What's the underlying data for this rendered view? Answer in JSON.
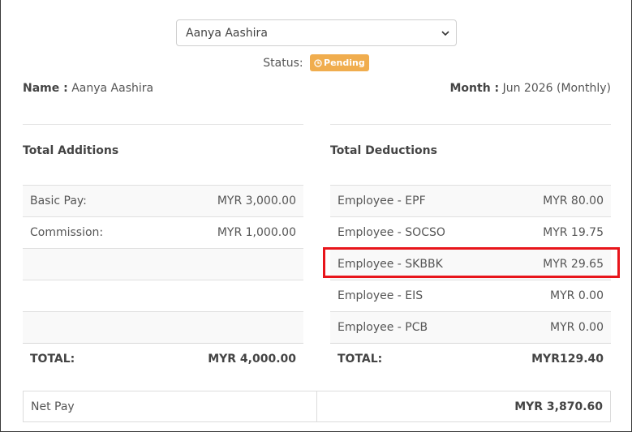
{
  "employee_select": {
    "value": "Aanya Aashira"
  },
  "status": {
    "label": "Status:",
    "badge": "Pending",
    "badge_color": "#f0ad4e"
  },
  "info": {
    "name_label": "Name :",
    "name_value": "Aanya Aashira",
    "month_label": "Month :",
    "month_value": "Jun 2026 (Monthly)"
  },
  "additions": {
    "title": "Total Additions",
    "rows": [
      {
        "label": "Basic Pay:",
        "amount": "MYR 3,000.00"
      },
      {
        "label": "Commission:",
        "amount": "MYR 1,000.00"
      },
      {
        "label": "",
        "amount": ""
      },
      {
        "label": "",
        "amount": ""
      },
      {
        "label": "",
        "amount": ""
      }
    ],
    "total_label": "TOTAL:",
    "total_amount": "MYR 4,000.00"
  },
  "deductions": {
    "title": "Total Deductions",
    "rows": [
      {
        "label": "Employee - EPF",
        "amount": "MYR 80.00"
      },
      {
        "label": "Employee - SOCSO",
        "amount": "MYR 19.75"
      },
      {
        "label": "Employee - SKBBK",
        "amount": "MYR 29.65"
      },
      {
        "label": "Employee - EIS",
        "amount": "MYR 0.00"
      },
      {
        "label": "Employee - PCB",
        "amount": "MYR 0.00"
      }
    ],
    "total_label": "TOTAL:",
    "total_amount": "MYR129.40"
  },
  "net_pay": {
    "label": "Net Pay",
    "amount": "MYR 3,870.60"
  },
  "highlight_color": "#e8151b"
}
